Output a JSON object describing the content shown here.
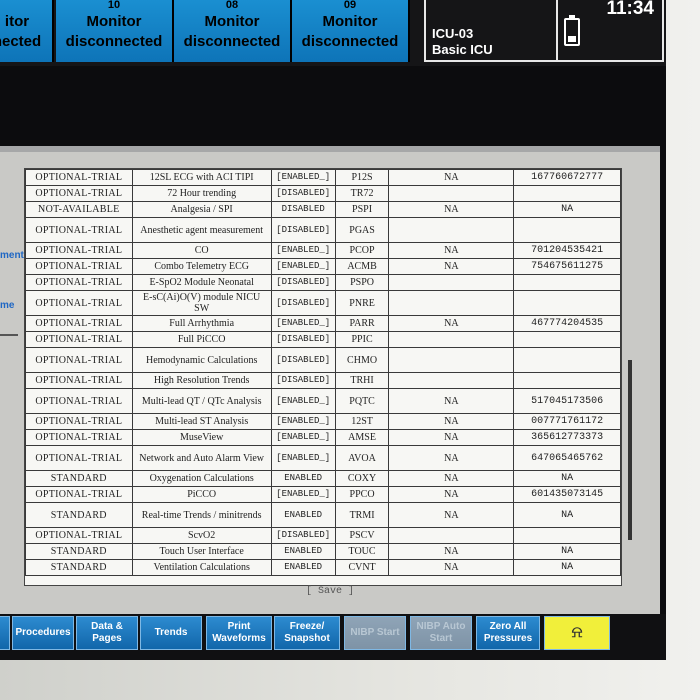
{
  "top_tiles": [
    {
      "num": "",
      "line1": "itor",
      "line2": "nected"
    },
    {
      "num": "10",
      "line1": "Monitor",
      "line2": "disconnected"
    },
    {
      "num": "08",
      "line1": "Monitor",
      "line2": "disconnected"
    },
    {
      "num": "09",
      "line1": "Monitor",
      "line2": "disconnected"
    }
  ],
  "bed": {
    "name": "ICU-03",
    "unit": "Basic ICU",
    "clock": "11:34"
  },
  "side": {
    "label1": "ment",
    "label2": "me"
  },
  "features": [
    {
      "status": "OPTIONAL-TRIAL",
      "name": "12SL ECG with ACI TIPI",
      "state": "[ENABLED_]",
      "code": "P12S",
      "na": "NA",
      "key": "167760672777"
    },
    {
      "status": "OPTIONAL-TRIAL",
      "name": "72 Hour trending",
      "state": "[DISABLED]",
      "code": "TR72",
      "na": "",
      "key": ""
    },
    {
      "status": "NOT-AVAILABLE",
      "name": "Analgesia / SPI",
      "state": "DISABLED",
      "code": "PSPI",
      "na": "NA",
      "key": "NA"
    },
    {
      "status": "OPTIONAL-TRIAL",
      "name": "Anesthetic agent measurement",
      "state": "[DISABLED]",
      "code": "PGAS",
      "na": "",
      "key": ""
    },
    {
      "status": "OPTIONAL-TRIAL",
      "name": "CO",
      "state": "[ENABLED_]",
      "code": "PCOP",
      "na": "NA",
      "key": "701204535421"
    },
    {
      "status": "OPTIONAL-TRIAL",
      "name": "Combo Telemetry ECG",
      "state": "[ENABLED_]",
      "code": "ACMB",
      "na": "NA",
      "key": "754675611275"
    },
    {
      "status": "OPTIONAL-TRIAL",
      "name": "E-SpO2 Module Neonatal",
      "state": "[DISABLED]",
      "code": "PSPO",
      "na": "",
      "key": ""
    },
    {
      "status": "OPTIONAL-TRIAL",
      "name": "E-sC(Ai)O(V) module NICU SW",
      "state": "[DISABLED]",
      "code": "PNRE",
      "na": "",
      "key": ""
    },
    {
      "status": "OPTIONAL-TRIAL",
      "name": "Full Arrhythmia",
      "state": "[ENABLED_]",
      "code": "PARR",
      "na": "NA",
      "key": "467774204535"
    },
    {
      "status": "OPTIONAL-TRIAL",
      "name": "Full PiCCO",
      "state": "[DISABLED]",
      "code": "PPIC",
      "na": "",
      "key": ""
    },
    {
      "status": "OPTIONAL-TRIAL",
      "name": "Hemodynamic Calculations",
      "state": "[DISABLED]",
      "code": "CHMO",
      "na": "",
      "key": ""
    },
    {
      "status": "OPTIONAL-TRIAL",
      "name": "High Resolution Trends",
      "state": "[DISABLED]",
      "code": "TRHI",
      "na": "",
      "key": ""
    },
    {
      "status": "OPTIONAL-TRIAL",
      "name": "Multi-lead QT / QTc Analysis",
      "state": "[ENABLED_]",
      "code": "PQTC",
      "na": "NA",
      "key": "517045173506"
    },
    {
      "status": "OPTIONAL-TRIAL",
      "name": "Multi-lead ST Analysis",
      "state": "[ENABLED_]",
      "code": "12ST",
      "na": "NA",
      "key": "007771761172"
    },
    {
      "status": "OPTIONAL-TRIAL",
      "name": "MuseView",
      "state": "[ENABLED_]",
      "code": "AMSE",
      "na": "NA",
      "key": "365612773373"
    },
    {
      "status": "OPTIONAL-TRIAL",
      "name": "Network and Auto Alarm View",
      "state": "[ENABLED_]",
      "code": "AVOA",
      "na": "NA",
      "key": "647065465762"
    },
    {
      "status": "STANDARD",
      "name": "Oxygenation Calculations",
      "state": "ENABLED",
      "code": "COXY",
      "na": "NA",
      "key": "NA"
    },
    {
      "status": "OPTIONAL-TRIAL",
      "name": "PiCCO",
      "state": "[ENABLED_]",
      "code": "PPCO",
      "na": "NA",
      "key": "601435073145"
    },
    {
      "status": "STANDARD",
      "name": "Real-time Trends / minitrends",
      "state": "ENABLED",
      "code": "TRMI",
      "na": "NA",
      "key": "NA"
    },
    {
      "status": "OPTIONAL-TRIAL",
      "name": "ScvO2",
      "state": "[DISABLED]",
      "code": "PSCV",
      "na": "",
      "key": ""
    },
    {
      "status": "STANDARD",
      "name": "Touch User Interface",
      "state": "ENABLED",
      "code": "TOUC",
      "na": "NA",
      "key": "NA"
    },
    {
      "status": "STANDARD",
      "name": "Ventilation Calculations",
      "state": "ENABLED",
      "code": "CVNT",
      "na": "NA",
      "key": "NA"
    }
  ],
  "save_label": "[ Save ]",
  "buttons": [
    {
      "id": "partial",
      "label": "",
      "disabled": false
    },
    {
      "id": "procedures",
      "label": "Procedures",
      "disabled": false
    },
    {
      "id": "data-pages",
      "label": "Data & Pages",
      "disabled": false
    },
    {
      "id": "trends",
      "label": "Trends",
      "disabled": false
    },
    {
      "id": "print-waveforms",
      "label": "Print Waveforms",
      "disabled": false
    },
    {
      "id": "freeze-snapshot",
      "label": "Freeze/ Snapshot",
      "disabled": false
    },
    {
      "id": "nibp-start",
      "label": "NIBP Start",
      "disabled": true
    },
    {
      "id": "nibp-auto-start",
      "label": "NIBP Auto Start",
      "disabled": true
    },
    {
      "id": "zero-all-pressures",
      "label": "Zero All Pressures",
      "disabled": false
    },
    {
      "id": "alarm-silence",
      "label": "⍾",
      "disabled": false
    }
  ]
}
